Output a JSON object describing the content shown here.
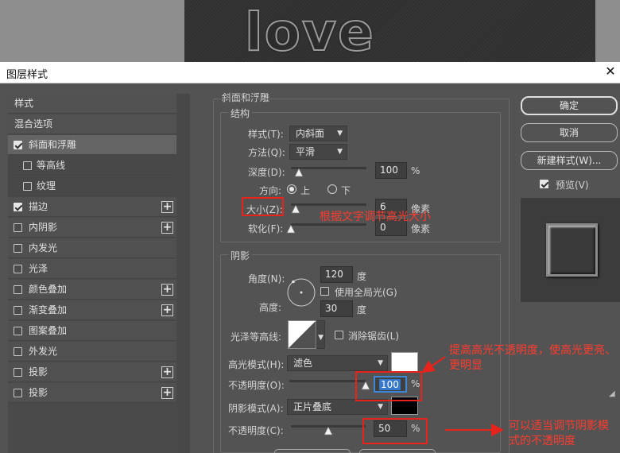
{
  "canvas": {
    "text": "love"
  },
  "dialog": {
    "title": "图层样式",
    "close_glyph": "✕"
  },
  "style_list": [
    {
      "label": "样式",
      "kind": "header"
    },
    {
      "label": "混合选项",
      "kind": "header"
    },
    {
      "label": "斜面和浮雕",
      "checked": true,
      "selected": true,
      "plus": false
    },
    {
      "label": "等高线",
      "checked": false,
      "sub": true
    },
    {
      "label": "纹理",
      "checked": false,
      "sub": true
    },
    {
      "label": "描边",
      "checked": true,
      "plus": true
    },
    {
      "label": "内阴影",
      "checked": false,
      "plus": true
    },
    {
      "label": "内发光",
      "checked": false,
      "plus": false
    },
    {
      "label": "光泽",
      "checked": false,
      "plus": false
    },
    {
      "label": "颜色叠加",
      "checked": false,
      "plus": true
    },
    {
      "label": "渐变叠加",
      "checked": false,
      "plus": true
    },
    {
      "label": "图案叠加",
      "checked": false,
      "plus": false
    },
    {
      "label": "外发光",
      "checked": false,
      "plus": false
    },
    {
      "label": "投影",
      "checked": false,
      "plus": true
    },
    {
      "label": "投影",
      "checked": false,
      "plus": true
    }
  ],
  "bevel": {
    "section_title": "斜面和浮雕",
    "structure_title": "结构",
    "style": {
      "label": "样式(T):",
      "value": "内斜面"
    },
    "technique": {
      "label": "方法(Q):",
      "value": "平滑"
    },
    "depth": {
      "label": "深度(D):",
      "value": "100",
      "unit": "%",
      "slider_fraction": 0.1
    },
    "direction": {
      "label": "方向:",
      "up": "上",
      "down": "下",
      "selected": "up"
    },
    "size": {
      "label": "大小(Z):",
      "value": "6",
      "unit": "像素",
      "slider_fraction": 0.06
    },
    "soften": {
      "label": "软化(F):",
      "value": "0",
      "unit": "像素",
      "slider_fraction": 0.0
    }
  },
  "shading": {
    "title": "阴影",
    "angle": {
      "label": "角度(N):",
      "value": "120",
      "unit": "度"
    },
    "global_light": {
      "label": "使用全局光(G)",
      "checked": false
    },
    "altitude": {
      "label": "高度:",
      "value": "30",
      "unit": "度"
    },
    "gloss_contour": {
      "label": "光泽等高线:"
    },
    "anti_aliased": {
      "label": "消除锯齿(L)",
      "checked": false
    },
    "highlight_mode": {
      "label": "高光模式(H):",
      "value": "滤色",
      "color": "#ffffff"
    },
    "highlight_opacity": {
      "label": "不透明度(O):",
      "value": "100",
      "unit": "%",
      "slider_fraction": 1.0
    },
    "shadow_mode": {
      "label": "阴影模式(A):",
      "value": "正片叠底",
      "color": "#000000"
    },
    "shadow_opacity": {
      "label": "不透明度(C):",
      "value": "50",
      "unit": "%",
      "slider_fraction": 0.5
    }
  },
  "buttons": {
    "ok": "确定",
    "cancel": "取消",
    "new_style": "新建样式(W)...",
    "preview": {
      "label": "预览(V)",
      "checked": true
    }
  },
  "annotations": {
    "size_note": "根据文字调节高光大小",
    "highlight_note": "提高高光不透明度，使高光更亮、更明显",
    "shadow_note": "可以适当调节阴影模式的不透明度",
    "color": "#e8231b"
  }
}
